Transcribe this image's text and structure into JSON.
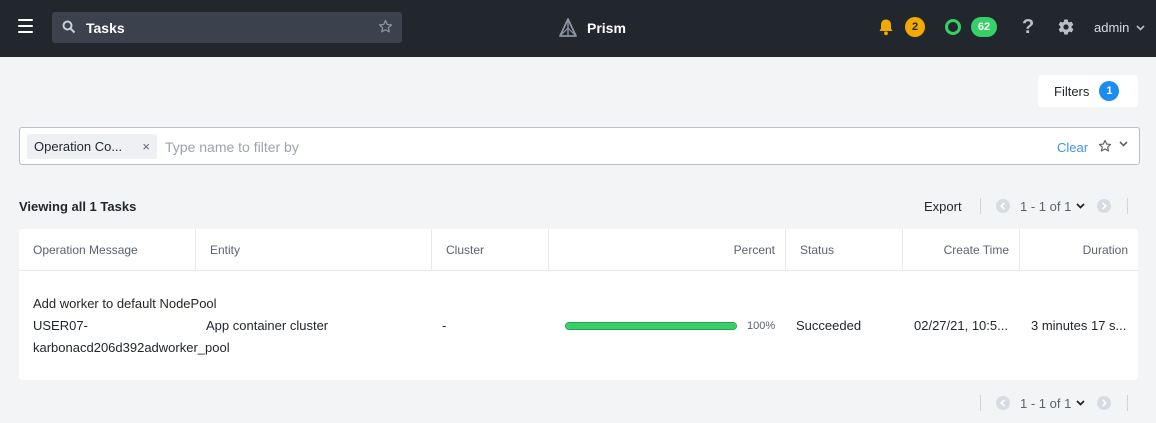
{
  "topbar": {
    "search_value": "Tasks",
    "app_name": "Prism",
    "alert_count": "2",
    "health_count": "62",
    "help_label": "?",
    "user": "admin",
    "colors": {
      "background": "#22272e",
      "alert": "#f2a900",
      "health": "#36d068"
    },
    "icons": [
      "hamburger-menu-icon",
      "search-icon",
      "star-icon",
      "prism-logo-icon",
      "bell-icon",
      "health-ring-icon",
      "help-icon",
      "gear-icon",
      "chevron-down-icon"
    ]
  },
  "filters_button": {
    "label": "Filters",
    "count": "1"
  },
  "filter_bar": {
    "chip_label": "Operation Co...",
    "chip_remove": "×",
    "placeholder": "Type name to filter by",
    "clear_label": "Clear"
  },
  "list": {
    "viewing_label": "Viewing all 1 Tasks",
    "export_label": "Export",
    "pagination": "1 - 1 of 1"
  },
  "table": {
    "columns": [
      "Operation Message",
      "Entity",
      "Cluster",
      "Percent",
      "Status",
      "Create Time",
      "Duration"
    ],
    "rows": [
      {
        "operation_message": "Add worker to default NodePool USER07-karbonacd206d392adworker_pool",
        "entity": "App container cluster",
        "cluster": "-",
        "percent": 100,
        "percent_label": "100%",
        "status": "Succeeded",
        "create_time": "02/27/21, 10:5...",
        "duration": "3 minutes 17 s..."
      }
    ]
  }
}
